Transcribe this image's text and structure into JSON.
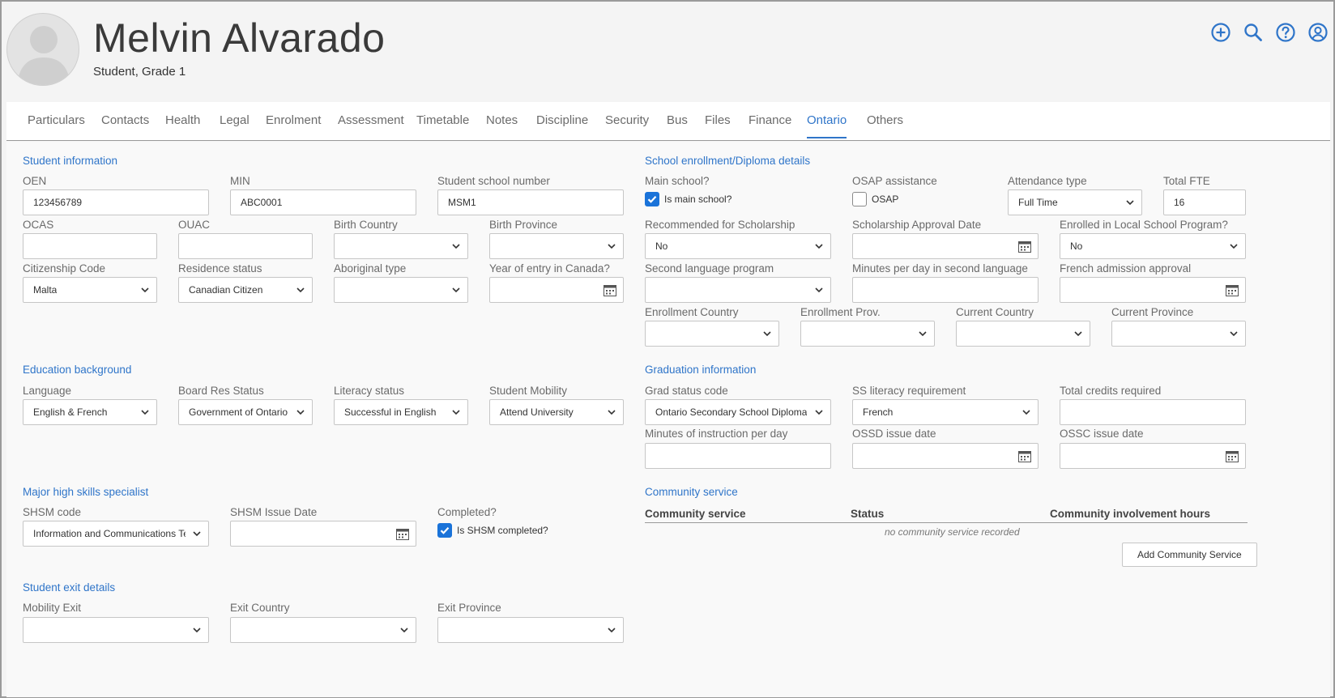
{
  "header": {
    "name": "Melvin Alvarado",
    "subtitle": "Student, Grade 1",
    "icons": [
      "add-circle-icon",
      "search-icon",
      "help-icon",
      "account-icon"
    ]
  },
  "tabs": [
    "Particulars",
    "Contacts",
    "Health",
    "Legal",
    "Enrolment",
    "Assessment",
    "Timetable",
    "Notes",
    "Discipline",
    "Security",
    "Bus",
    "Files",
    "Finance",
    "Ontario",
    "Others"
  ],
  "active_tab": "Ontario",
  "colors": {
    "accent": "#2f75c9",
    "checkbox": "#1a73d9"
  },
  "student_info": {
    "title": "Student information",
    "oen_label": "OEN",
    "oen": "123456789",
    "min_label": "MIN",
    "min": "ABC0001",
    "school_number_label": "Student school number",
    "school_number": "MSM1",
    "ocas_label": "OCAS",
    "ocas": "",
    "ouac_label": "OUAC",
    "ouac": "",
    "birth_country_label": "Birth Country",
    "birth_country": "",
    "birth_province_label": "Birth Province",
    "birth_province": "",
    "citizenship_label": "Citizenship Code",
    "citizenship": "Malta",
    "residence_label": "Residence status",
    "residence": "Canadian Citizen",
    "aboriginal_label": "Aboriginal type",
    "aboriginal": "",
    "year_entry_label": "Year of entry in Canada?",
    "year_entry": ""
  },
  "enrollment": {
    "title": "School enrollment/Diploma details",
    "main_school_label": "Main school?",
    "main_school_check": "Is main school?",
    "main_school_checked": true,
    "osap_label": "OSAP assistance",
    "osap_check": "OSAP",
    "osap_checked": false,
    "attendance_label": "Attendance type",
    "attendance": "Full Time",
    "fte_label": "Total FTE",
    "fte": "16",
    "scholarship_label": "Recommended for Scholarship",
    "scholarship": "No",
    "scholarship_date_label": "Scholarship Approval Date",
    "scholarship_date": "",
    "local_program_label": "Enrolled in Local School Program?",
    "local_program": "No",
    "second_lang_label": "Second language program",
    "second_lang": "",
    "minutes_second_label": "Minutes per day in second language",
    "minutes_second": "",
    "french_admission_label": "French admission approval",
    "french_admission": "",
    "enroll_country_label": "Enrollment Country",
    "enroll_country": "",
    "enroll_prov_label": "Enrollment Prov.",
    "enroll_prov": "",
    "current_country_label": "Current Country",
    "current_country": "",
    "current_province_label": "Current Province",
    "current_province": ""
  },
  "education": {
    "title": "Education background",
    "language_label": "Language",
    "language": "English & French",
    "board_res_label": "Board Res Status",
    "board_res": "Government of Ontario",
    "literacy_label": "Literacy status",
    "literacy": "Successful in English",
    "mobility_label": "Student Mobility",
    "mobility": "Attend University"
  },
  "graduation": {
    "title": "Graduation information",
    "grad_status_label": "Grad status code",
    "grad_status": "Ontario Secondary School Diploma",
    "ss_literacy_label": "SS literacy requirement",
    "ss_literacy": "French",
    "total_credits_label": "Total credits required",
    "total_credits": "",
    "minutes_instruction_label": "Minutes of instruction per day",
    "minutes_instruction": "",
    "ossd_label": "OSSD issue date",
    "ossd": "",
    "ossc_label": "OSSC issue date",
    "ossc": ""
  },
  "shsm": {
    "title": "Major high skills specialist",
    "code_label": "SHSM code",
    "code": "Information and Communications Technology",
    "issue_label": "SHSM Issue Date",
    "issue": "",
    "completed_label": "Completed?",
    "completed_check": "Is SHSM completed?",
    "completed_checked": true
  },
  "community": {
    "title": "Community service",
    "columns": [
      "Community service",
      "Status",
      "Community involvement hours"
    ],
    "empty_text": "no community service recorded",
    "add_button": "Add Community Service"
  },
  "exit": {
    "title": "Student exit details",
    "mobility_exit_label": "Mobility Exit",
    "mobility_exit": "",
    "exit_country_label": "Exit Country",
    "exit_country": "",
    "exit_province_label": "Exit Province",
    "exit_province": ""
  }
}
